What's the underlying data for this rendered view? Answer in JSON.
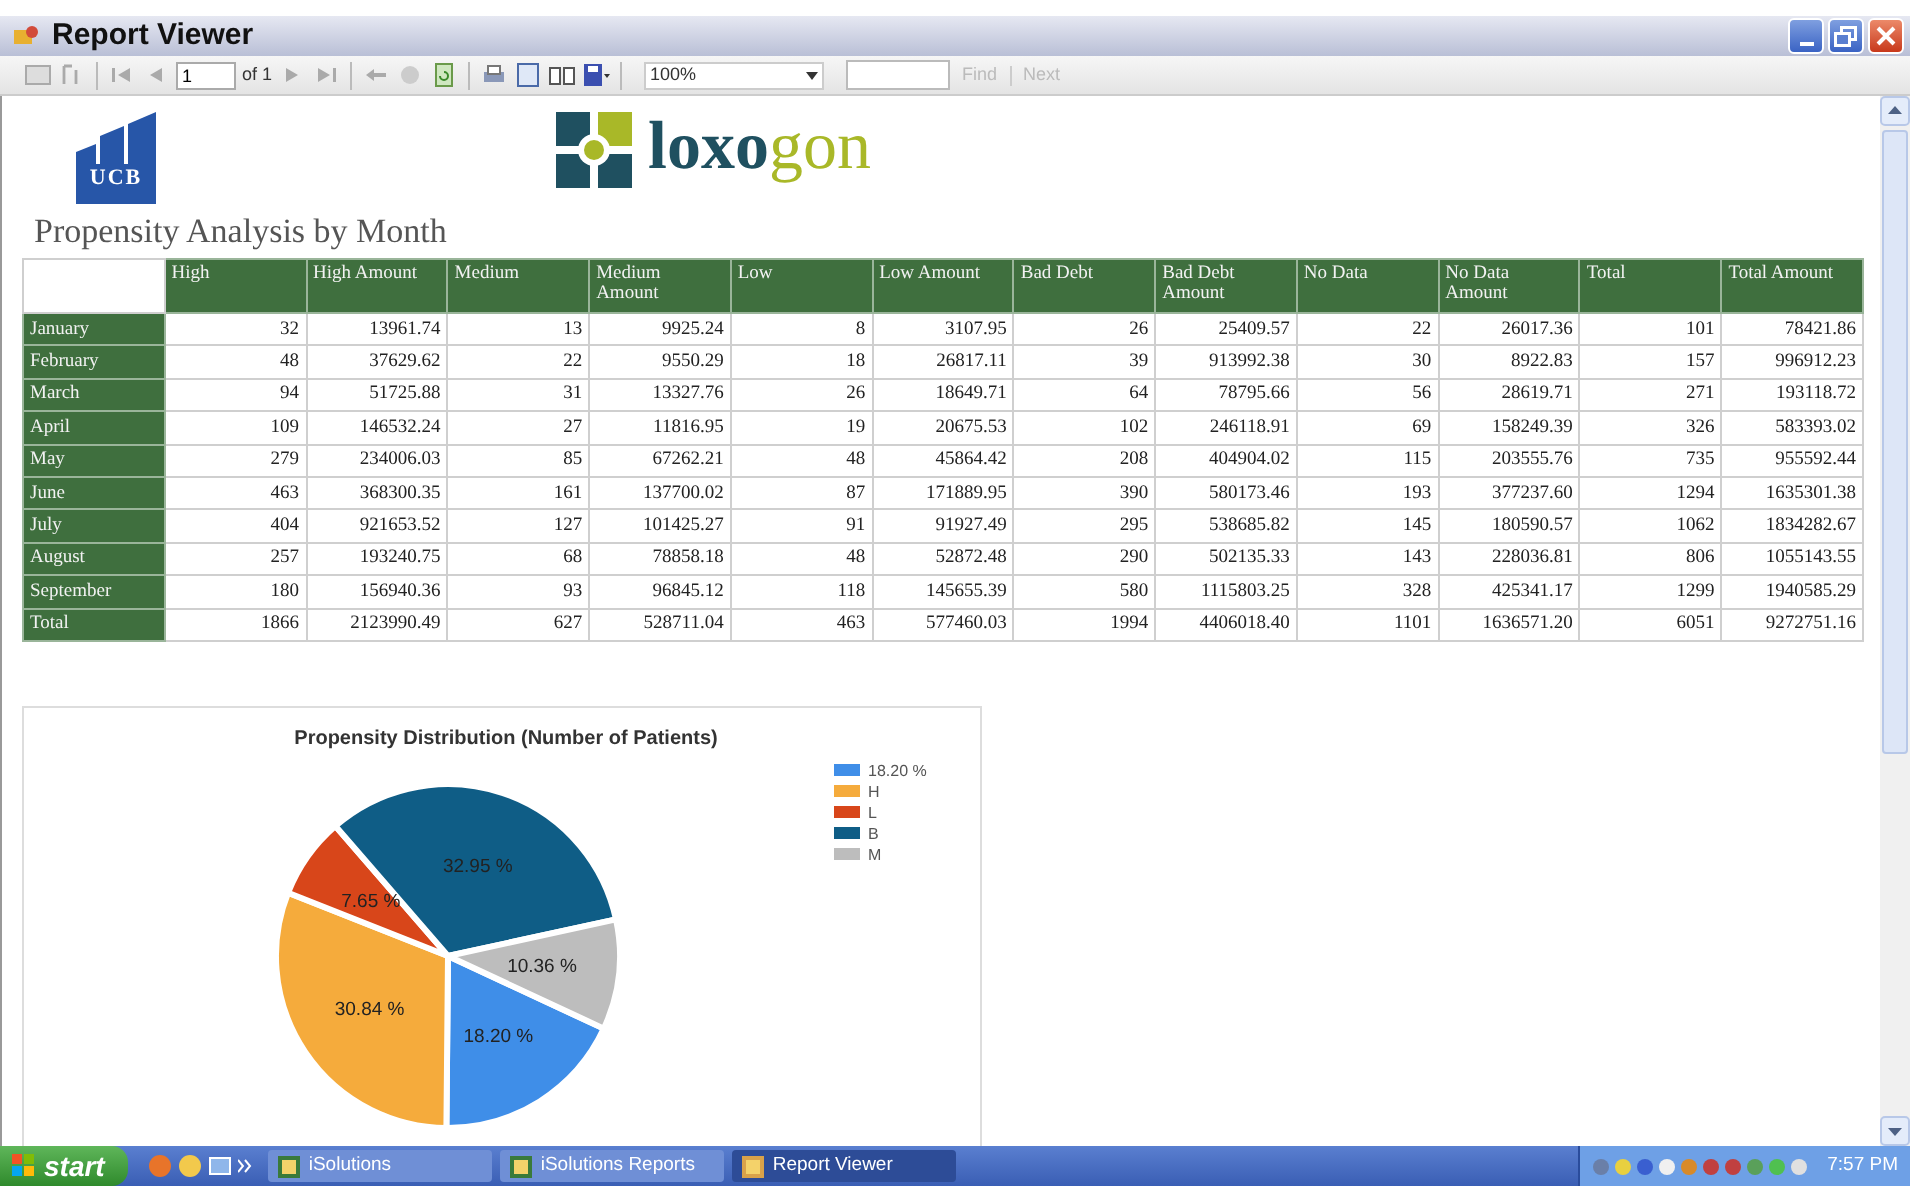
{
  "window": {
    "title": "Report Viewer"
  },
  "toolbar": {
    "page": "1",
    "page_count": "of 1",
    "zoom": "100%",
    "find": {
      "label": "Find",
      "disabled": true
    },
    "next": {
      "label": "Next",
      "disabled": true
    }
  },
  "report": {
    "ucb_logo": {
      "text": "UCB"
    },
    "brand_logo": {
      "parts": [
        {
          "text": "loxo",
          "color": "#1f5060"
        },
        {
          "text": "gon",
          "color": "#a9b828"
        }
      ]
    },
    "title": "Propensity Analysis by Month",
    "table": {
      "columns": [
        "High",
        "High Amount",
        "Medium",
        "Medium Amount",
        "Low",
        "Low Amount",
        "Bad Debt",
        "Bad Debt Amount",
        "No Data",
        "No Data Amount",
        "Total",
        "Total Amount"
      ],
      "rows": [
        {
          "label": "January",
          "cells": [
            "32",
            "13961.74",
            "13",
            "9925.24",
            "8",
            "3107.95",
            "26",
            "25409.57",
            "22",
            "26017.36",
            "101",
            "78421.86"
          ]
        },
        {
          "label": "February",
          "cells": [
            "48",
            "37629.62",
            "22",
            "9550.29",
            "18",
            "26817.11",
            "39",
            "913992.38",
            "30",
            "8922.83",
            "157",
            "996912.23"
          ]
        },
        {
          "label": "March",
          "cells": [
            "94",
            "51725.88",
            "31",
            "13327.76",
            "26",
            "18649.71",
            "64",
            "78795.66",
            "56",
            "28619.71",
            "271",
            "193118.72"
          ]
        },
        {
          "label": "April",
          "cells": [
            "109",
            "146532.24",
            "27",
            "11816.95",
            "19",
            "20675.53",
            "102",
            "246118.91",
            "69",
            "158249.39",
            "326",
            "583393.02"
          ]
        },
        {
          "label": "May",
          "cells": [
            "279",
            "234006.03",
            "85",
            "67262.21",
            "48",
            "45864.42",
            "208",
            "404904.02",
            "115",
            "203555.76",
            "735",
            "955592.44"
          ]
        },
        {
          "label": "June",
          "cells": [
            "463",
            "368300.35",
            "161",
            "137700.02",
            "87",
            "171889.95",
            "390",
            "580173.46",
            "193",
            "377237.60",
            "1294",
            "1635301.38"
          ]
        },
        {
          "label": "July",
          "cells": [
            "404",
            "921653.52",
            "127",
            "101425.27",
            "91",
            "91927.49",
            "295",
            "538685.82",
            "145",
            "180590.57",
            "1062",
            "1834282.67"
          ]
        },
        {
          "label": "August",
          "cells": [
            "257",
            "193240.75",
            "68",
            "78858.18",
            "48",
            "52872.48",
            "290",
            "502135.33",
            "143",
            "228036.81",
            "806",
            "1055143.55"
          ]
        },
        {
          "label": "September",
          "cells": [
            "180",
            "156940.36",
            "93",
            "96845.12",
            "118",
            "145655.39",
            "580",
            "1115803.25",
            "328",
            "425341.17",
            "1299",
            "1940585.29"
          ]
        },
        {
          "label": "Total",
          "cells": [
            "1866",
            "2123990.49",
            "627",
            "528711.04",
            "463",
            "577460.03",
            "1994",
            "4406018.40",
            "1101",
            "1636571.20",
            "6051",
            "9272751.16"
          ]
        }
      ]
    },
    "chart": {
      "chart_data": {
        "type": "pie",
        "title": "Propensity Distribution (Number of Patients)",
        "categories": [
          "18.20 %",
          "H",
          "L",
          "B",
          "M"
        ],
        "series": [
          {
            "values": [
              18.2,
              30.84,
              7.65,
              32.95,
              10.36
            ]
          }
        ],
        "value_labels": [
          "18.20 %",
          "30.84 %",
          "7.65 %",
          "32.95 %",
          "10.36 %"
        ],
        "legend": "right"
      }
    }
  },
  "taskbar": {
    "start": "start",
    "tasks": [
      {
        "label": "iSolutions",
        "selected": false
      },
      {
        "label": "iSolutions Reports",
        "selected": false
      },
      {
        "label": "Report Viewer",
        "selected": true
      }
    ],
    "clock": "7:57 PM"
  }
}
